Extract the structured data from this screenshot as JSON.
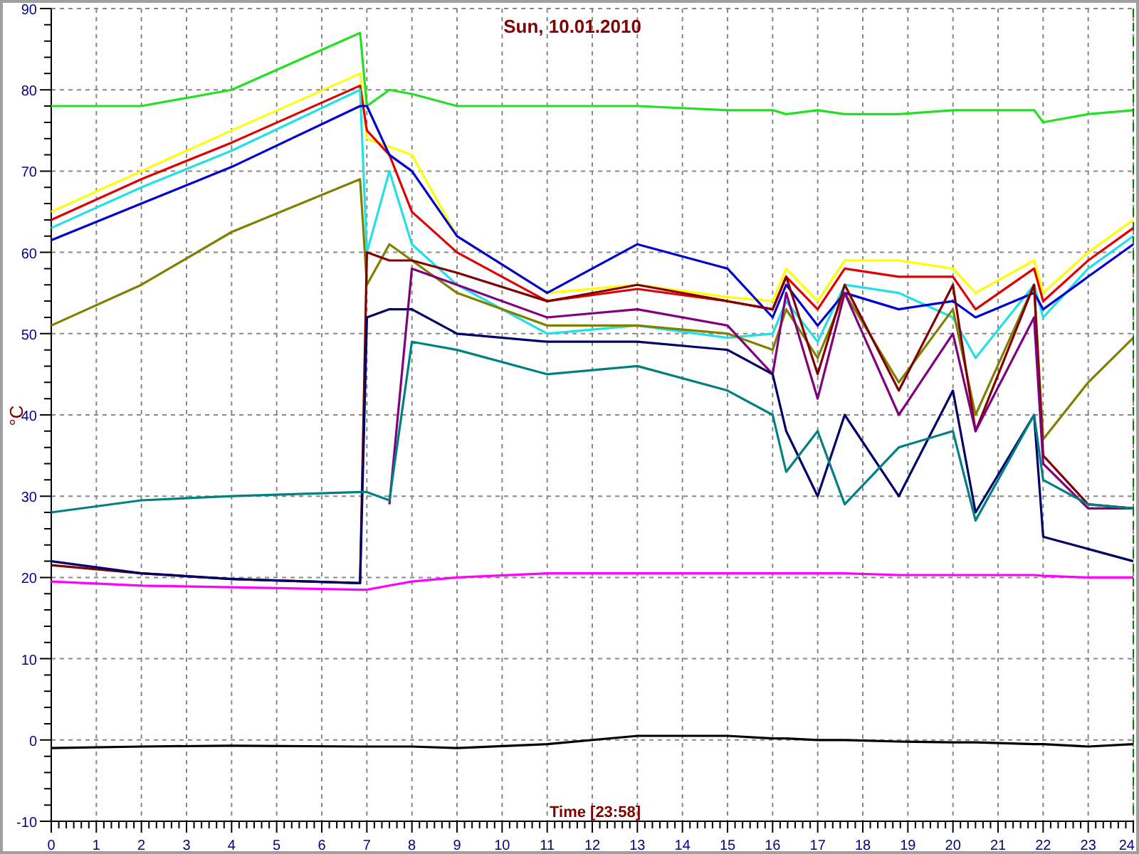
{
  "chart": {
    "chart_data": {
      "type": "line",
      "title": "Sun, 10.01.2010",
      "grid": true,
      "xlabel": "Time [23:58]",
      "ylabel": "°C",
      "x": [
        0,
        2,
        4,
        6.85,
        7,
        7.5,
        8,
        9,
        11,
        13,
        15,
        16,
        16.3,
        17,
        17.6,
        18.8,
        20,
        20.5,
        21.8,
        22,
        23,
        24
      ],
      "xlim": [
        0,
        24
      ],
      "ylim": [
        -10,
        90
      ],
      "xticks": [
        0,
        1,
        2,
        3,
        4,
        5,
        6,
        7,
        8,
        9,
        10,
        11,
        12,
        13,
        14,
        15,
        16,
        17,
        18,
        19,
        20,
        21,
        22,
        23,
        24
      ],
      "yticks": [
        -10,
        0,
        10,
        20,
        30,
        40,
        50,
        60,
        70,
        80,
        90
      ],
      "series": [
        {
          "color": "#22e022",
          "values": [
            78,
            78,
            80,
            87,
            78,
            80,
            79.5,
            78,
            78,
            78,
            77.5,
            77.5,
            77,
            77.5,
            77,
            77,
            77.5,
            77.5,
            77.5,
            76,
            77,
            77.5
          ]
        },
        {
          "color": "#ffff00",
          "values": [
            65,
            70,
            75,
            82,
            74,
            73,
            72,
            62,
            55,
            56,
            54.5,
            54,
            58,
            54,
            59,
            59,
            58,
            55,
            59,
            55,
            60,
            64
          ]
        },
        {
          "color": "#e00000",
          "values": [
            64,
            69,
            73.5,
            80.5,
            75,
            72,
            65,
            60,
            54,
            55.5,
            54,
            53,
            57,
            53,
            58,
            57,
            57,
            53,
            58,
            54,
            59,
            63
          ]
        },
        {
          "color": "#22e0e8",
          "values": [
            63,
            68,
            72.5,
            80,
            60,
            70,
            61,
            56,
            50,
            51,
            49.5,
            50,
            54,
            49,
            56,
            55,
            52,
            47,
            56,
            52,
            58,
            62
          ]
        },
        {
          "color": "#0000d0",
          "values": [
            61.5,
            66,
            70.5,
            78,
            78,
            72,
            70,
            62,
            55,
            61,
            58,
            52,
            56,
            51,
            55,
            53,
            54,
            52,
            55,
            53,
            57,
            61
          ]
        },
        {
          "color": "#808000",
          "values": [
            51,
            56,
            62.5,
            69,
            56,
            61,
            59,
            55,
            51,
            51,
            50,
            48,
            53,
            47,
            55,
            44,
            53,
            40,
            56,
            37,
            44,
            49.5
          ]
        },
        {
          "color": "#800000",
          "values": [
            21.5,
            20.5,
            19.8,
            19.3,
            60,
            59,
            59,
            57.5,
            54,
            56,
            54,
            53,
            57,
            45,
            56,
            43,
            56,
            38,
            56,
            35,
            29,
            28.5
          ]
        },
        {
          "color": "#800080",
          "values": [
            null,
            null,
            null,
            null,
            null,
            29,
            58,
            56,
            52,
            53,
            51,
            45,
            55,
            42,
            55,
            40,
            50,
            38,
            52,
            34,
            28.5,
            28.5
          ]
        },
        {
          "color": "#000066",
          "values": [
            22,
            20.5,
            19.8,
            19.3,
            52,
            53,
            53,
            50,
            49,
            49,
            48,
            45,
            38,
            30,
            40,
            30,
            43,
            28,
            40,
            25,
            23.5,
            22
          ]
        },
        {
          "color": "#008080",
          "values": [
            28,
            29.5,
            30,
            30.5,
            30.5,
            29.5,
            49,
            48,
            45,
            46,
            43,
            40,
            33,
            38,
            29,
            36,
            38,
            27,
            40,
            32,
            29,
            28.5
          ]
        },
        {
          "color": "#ff00ff",
          "values": [
            19.5,
            19,
            18.8,
            18.5,
            18.5,
            19,
            19.5,
            20,
            20.5,
            20.5,
            20.5,
            20.5,
            20.5,
            20.5,
            20.5,
            20.3,
            20.3,
            20.3,
            20.3,
            20.2,
            20,
            20
          ]
        },
        {
          "color": "#000000",
          "values": [
            -1,
            -0.8,
            -0.7,
            -0.8,
            -0.8,
            -0.8,
            -0.8,
            -1,
            -0.5,
            0.5,
            0.5,
            0.2,
            0.2,
            0,
            0,
            -0.2,
            -0.3,
            -0.3,
            -0.5,
            -0.5,
            -0.8,
            -0.5
          ]
        }
      ]
    }
  }
}
